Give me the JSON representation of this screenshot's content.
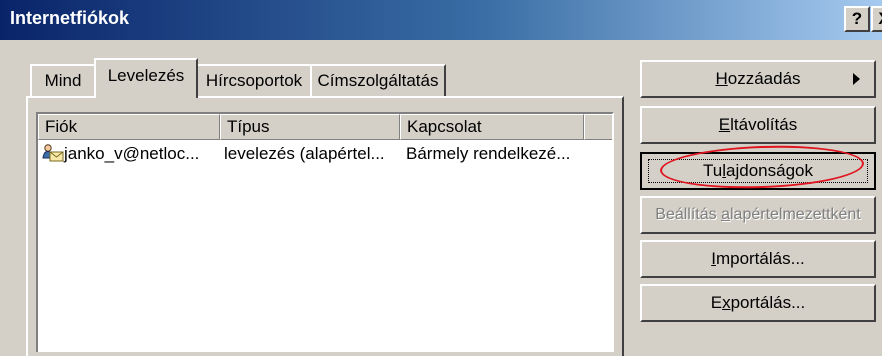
{
  "window": {
    "title": "Internetfiókok",
    "help_label": "?",
    "close_label": "X"
  },
  "tabs": [
    {
      "label": "Mind",
      "active": false
    },
    {
      "label": "Levelezés",
      "active": true
    },
    {
      "label": "Hírcsoportok",
      "active": false
    },
    {
      "label": "Címszolgáltatás",
      "active": false
    }
  ],
  "list": {
    "columns": [
      "Fiók",
      "Típus",
      "Kapcsolat",
      ""
    ],
    "rows": [
      {
        "account": "janko_v@netloc...",
        "type": "levelezés (alapértel...",
        "connection": "Bármely rendelkezé...",
        "icon": "mail-account-icon"
      }
    ]
  },
  "buttons": {
    "add": {
      "pre": "",
      "key": "H",
      "post": "ozzáadás"
    },
    "remove": {
      "pre": "",
      "key": "E",
      "post": "ltávolítás"
    },
    "properties": {
      "pre": "Tu",
      "key": "l",
      "post": "ajdonságok"
    },
    "set_default": {
      "pre": "Beállítás ",
      "key": "a",
      "post": "lapértelmezettként"
    },
    "import": {
      "pre": "",
      "key": "I",
      "post": "mportálás..."
    },
    "export": {
      "pre": "E",
      "key": "x",
      "post": "portálás..."
    }
  },
  "colors": {
    "title_bar_start": "#0a246a",
    "title_bar_end": "#a6caf0",
    "annotation_ellipse": "#e0141e"
  }
}
